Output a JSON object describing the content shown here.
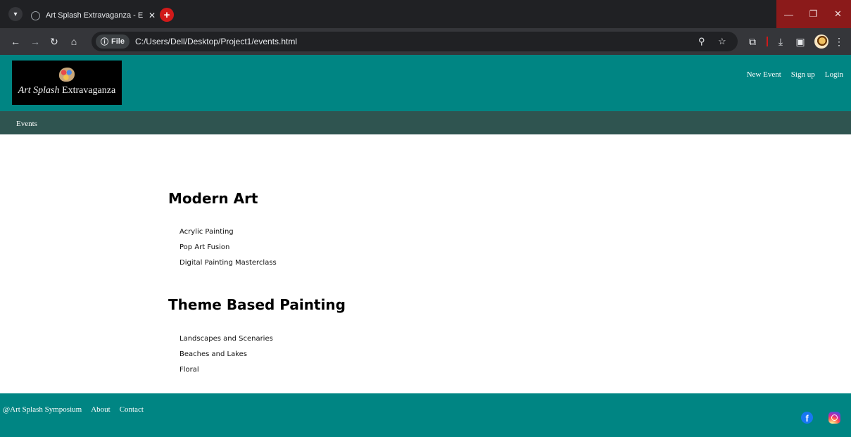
{
  "browser": {
    "tab_title": "Art Splash Extravaganza - Events",
    "tab_close": "✕",
    "new_tab": "+",
    "file_chip": "File",
    "url": "C:/Users/Dell/Desktop/Project1/events.html",
    "window_controls": {
      "minimize": "—",
      "restore": "❐",
      "close": "✕"
    }
  },
  "header": {
    "logo_script": "Art Splash",
    "logo_rest": " Extravaganza",
    "nav": [
      "New Event",
      "Sign up",
      "Login"
    ]
  },
  "subnav": {
    "events": "Events"
  },
  "sections": [
    {
      "heading": "Modern Art",
      "items": [
        "Acrylic Painting",
        "Pop Art Fusion",
        "Digital Painting Masterclass"
      ]
    },
    {
      "heading": "Theme Based Painting",
      "items": [
        "Landscapes and Scenaries",
        "Beaches and Lakes",
        "Floral"
      ]
    }
  ],
  "footer": {
    "copyright": "@Art Splash Symposium",
    "links": [
      "About",
      "Contact"
    ],
    "facebook_glyph": "f"
  },
  "colors": {
    "header_bg": "#008583",
    "subnav_bg": "#2f5450",
    "footer_bg": "#008583",
    "new_tab_red": "#d11a1a"
  },
  "icons": [
    "chevron-down-icon",
    "globe-icon",
    "close-icon",
    "plus-icon",
    "back-icon",
    "forward-icon",
    "reload-icon",
    "home-icon",
    "info-icon",
    "zoom-icon",
    "star-icon",
    "extensions-icon",
    "download-icon",
    "sidepanel-icon",
    "menu-icon",
    "facebook-icon",
    "instagram-icon"
  ]
}
